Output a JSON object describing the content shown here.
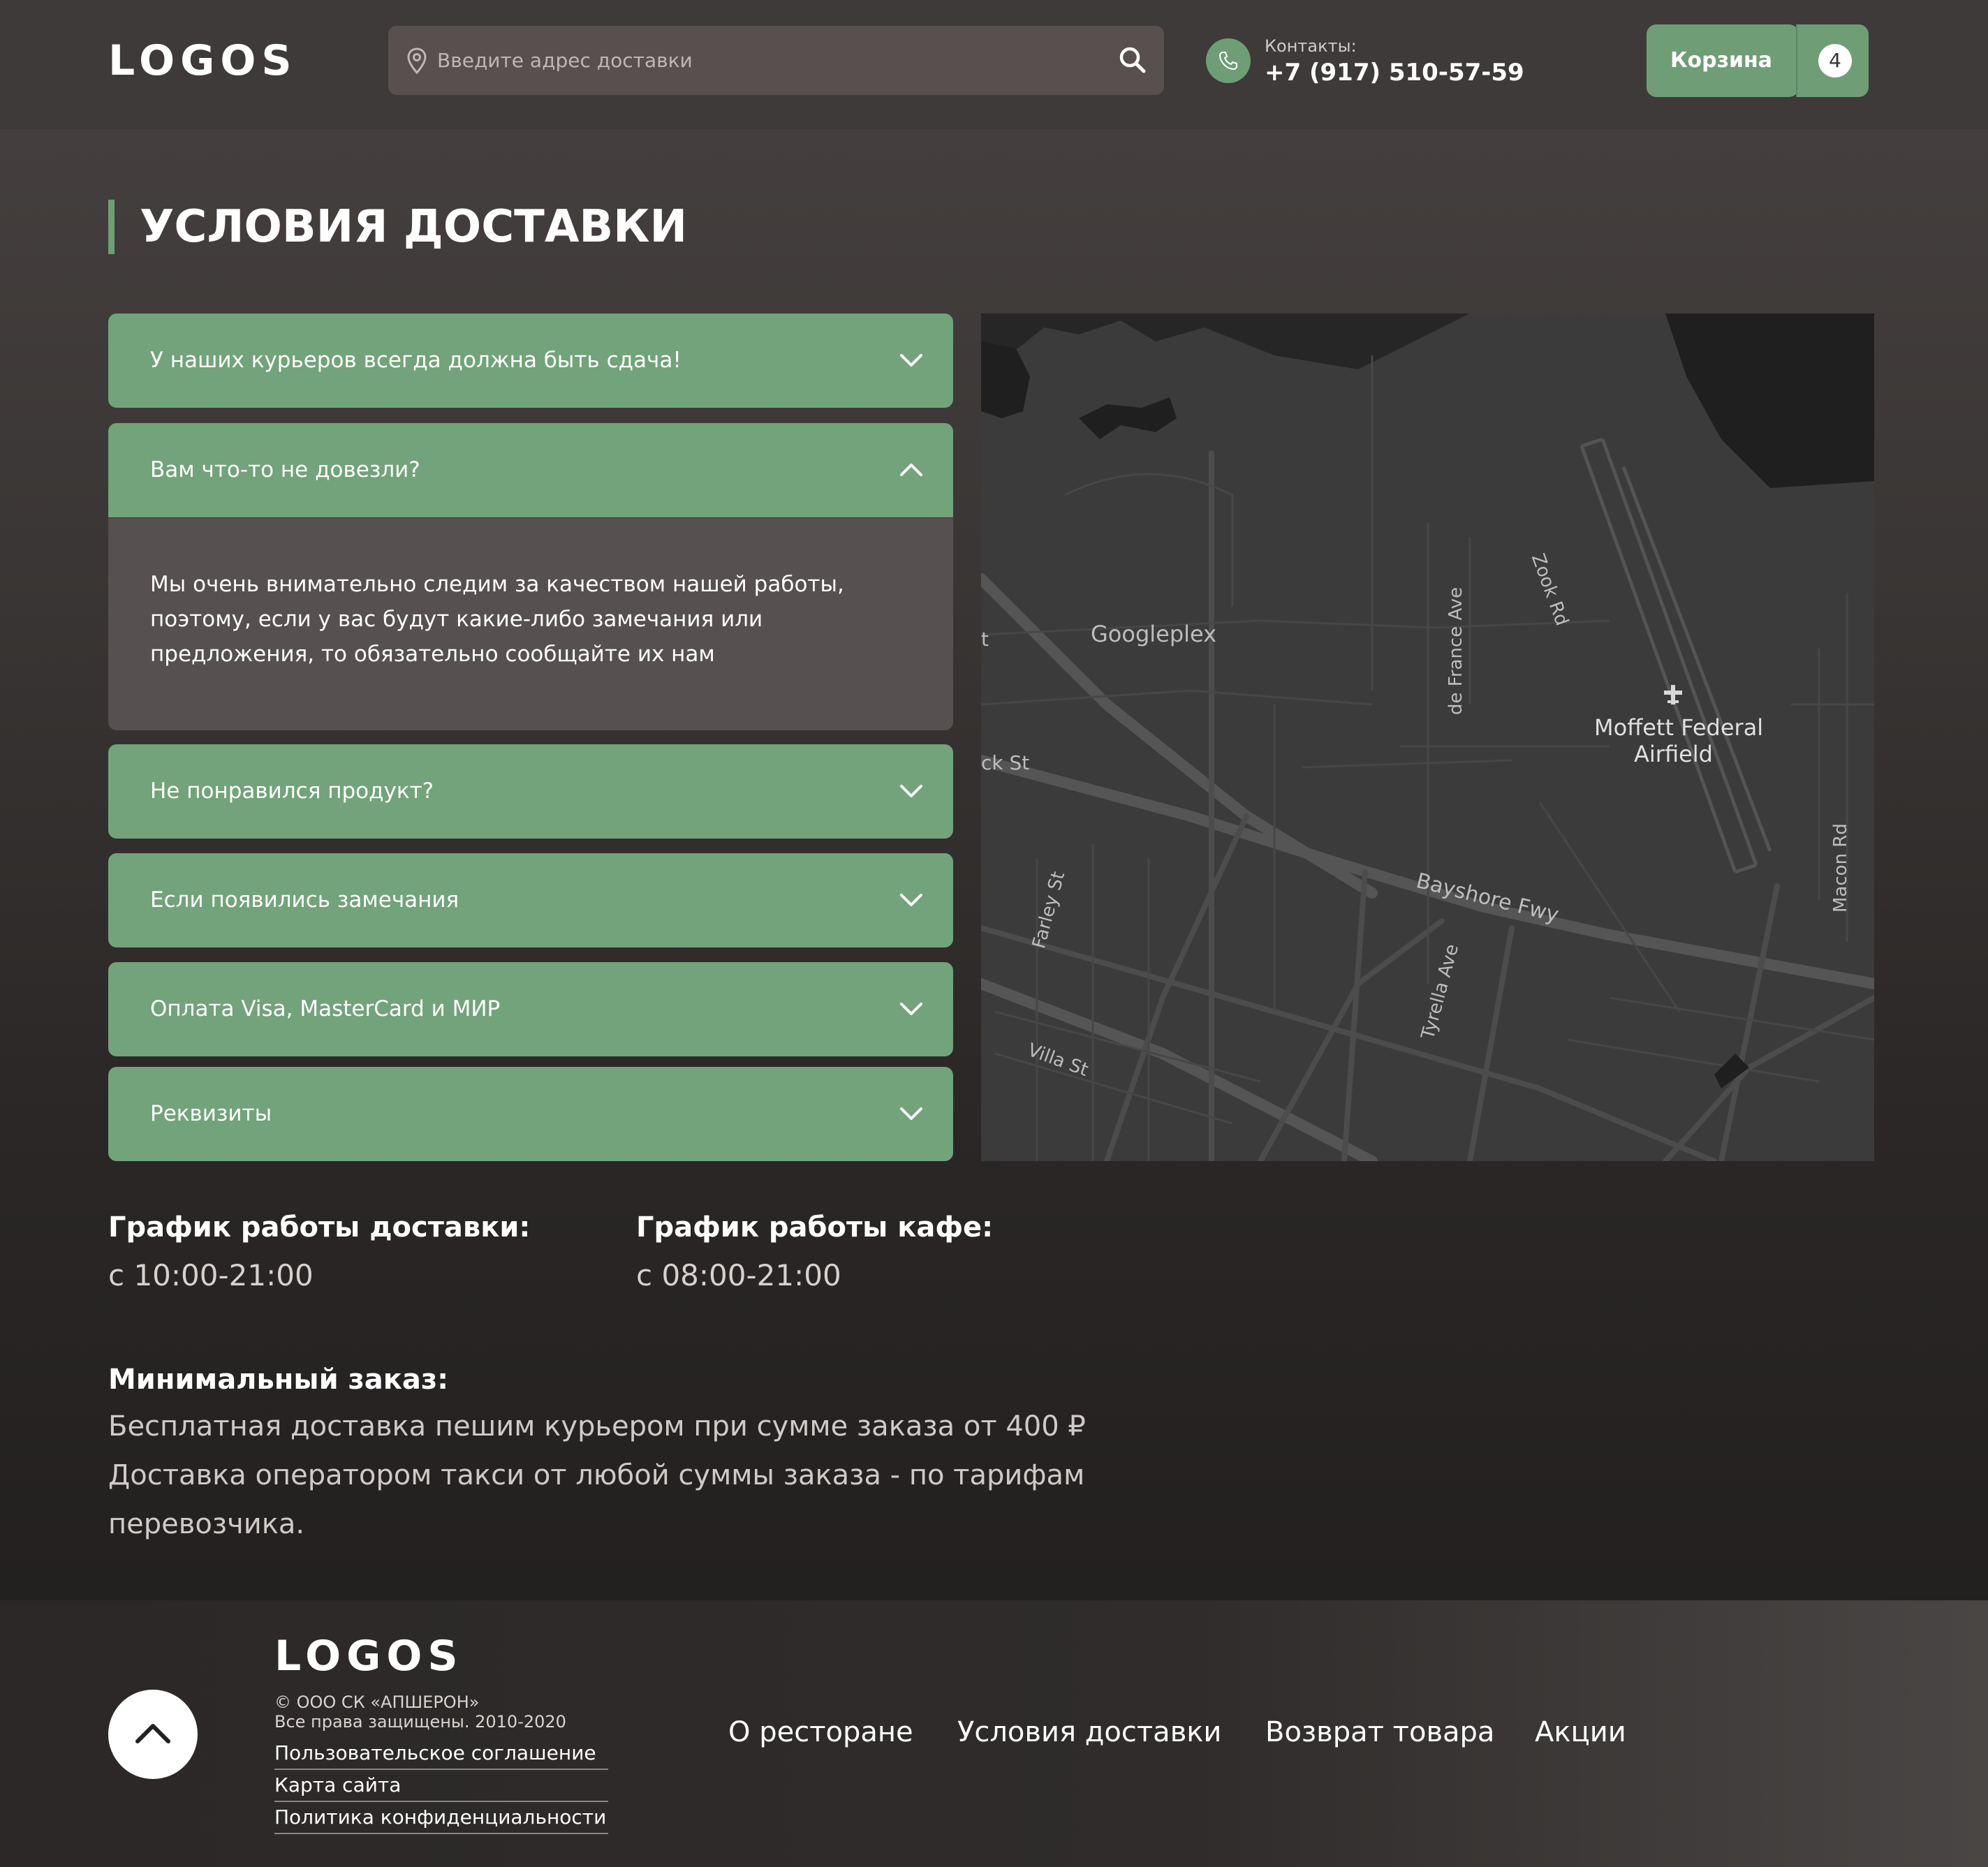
{
  "header": {
    "logo": "LOGOS",
    "search_placeholder": "Введите адрес доставки",
    "contacts_label": "Контакты:",
    "contacts_phone": "+7 (917) 510-57-59",
    "cart_label": "Корзина",
    "cart_count": "4"
  },
  "page": {
    "title": "УСЛОВИЯ ДОСТАВКИ"
  },
  "accordion": {
    "items": [
      {
        "label": "У наших курьеров всегда должна быть сдача!",
        "expanded": false
      },
      {
        "label": "Вам что-то не довезли?",
        "expanded": true
      },
      {
        "label": "Не понравился продукт?",
        "expanded": false
      },
      {
        "label": "Если появились замечания",
        "expanded": false
      },
      {
        "label": "Оплата Visa, MasterCard и МИР",
        "expanded": false
      },
      {
        "label": "Реквизиты",
        "expanded": false
      }
    ],
    "open_body": "Мы очень внимательно следим за качеством нашей работы, поэтому, если у вас будут какие-либо замечания или предложения, то обязательно сообщайте их нам"
  },
  "map": {
    "labels": {
      "googleplex": "Googleplex",
      "moffett_1": "Moffett Federal",
      "moffett_2": "Airfield",
      "bayshore": "Bayshore Fwy",
      "de_france": "de France Ave",
      "zook": "Zook Rd",
      "farley": "Farley St",
      "tyrella": "Tyrella Ave",
      "villa": "Villa St",
      "macon": "Macon Rd",
      "ck_st": "ck St",
      "t": "t"
    }
  },
  "schedule": {
    "delivery_title": "График работы доставки:",
    "delivery_value": "с 10:00-21:00",
    "cafe_title": "График работы кафе:",
    "cafe_value": "с 08:00-21:00"
  },
  "minimum": {
    "title": "Минимальный заказ:",
    "line1": "Бесплатная доставка пешим курьером при сумме заказа от 400 ₽",
    "line2": "Доставка оператором такси от любой суммы заказа - по тарифам",
    "line3": "перевозчика."
  },
  "footer": {
    "logo": "LOGOS",
    "copyright": "© ООО СК «АПШЕРОН»",
    "rights": "Все права защищены. 2010-2020",
    "links": [
      "Пользовательское соглашение",
      "Карта сайта",
      "Политика конфиденциальности"
    ],
    "nav": [
      "О ресторане",
      "Условия доставки",
      "Возврат товара",
      "Акции"
    ]
  },
  "colors": {
    "accent": "#72a37a",
    "header_bg": "#3e3a39",
    "expanded_body_bg": "#565050"
  }
}
